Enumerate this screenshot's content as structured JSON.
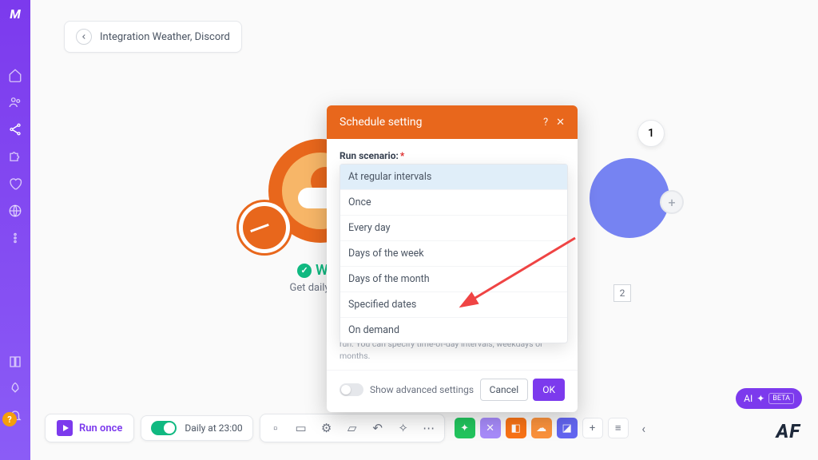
{
  "breadcrumb": {
    "title": "Integration Weather, Discord"
  },
  "module": {
    "title": "Wea",
    "sub": "Get daily wea"
  },
  "indicators": {
    "one": "1",
    "two": "2"
  },
  "modal": {
    "title": "Schedule setting",
    "field_label": "Run scenario:",
    "selected": "At regular intervals",
    "options": [
      "At regular intervals",
      "Once",
      "Every day",
      "Days of the week",
      "Days of the month",
      "Specified dates",
      "On demand"
    ],
    "help": "run. You can specify time-of-day intervals, weekdays or months.",
    "adv": "Show advanced settings",
    "cancel": "Cancel",
    "ok": "OK"
  },
  "toolbar": {
    "run": "Run once",
    "schedule": "Daily at 23:00"
  },
  "ai": {
    "label": "AI",
    "beta": "BETA"
  },
  "watermark": "AF"
}
